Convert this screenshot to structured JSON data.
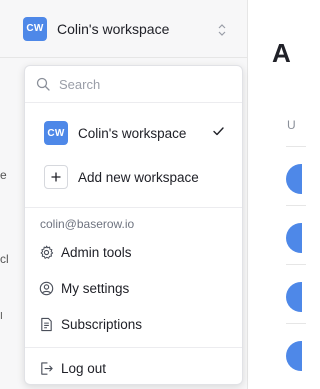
{
  "workspace": {
    "initials": "CW",
    "name": "Colin's workspace",
    "badge_color": "#4e88e8"
  },
  "main": {
    "title_fragment": "A",
    "column_fragment": "U"
  },
  "sidebar_fragments": [
    "e",
    "cl",
    "I"
  ],
  "dropdown": {
    "search_placeholder": "Search",
    "workspaces": [
      {
        "initials": "CW",
        "name": "Colin's workspace",
        "selected": true
      }
    ],
    "add_workspace_label": "Add new workspace",
    "user_email": "colin@baserow.io",
    "menu_items": [
      {
        "label": "Admin tools",
        "icon": "gear-icon"
      },
      {
        "label": "My settings",
        "icon": "user-circle-icon"
      },
      {
        "label": "Subscriptions",
        "icon": "document-icon"
      }
    ],
    "logout_label": "Log out",
    "logout_icon": "logout-icon"
  }
}
